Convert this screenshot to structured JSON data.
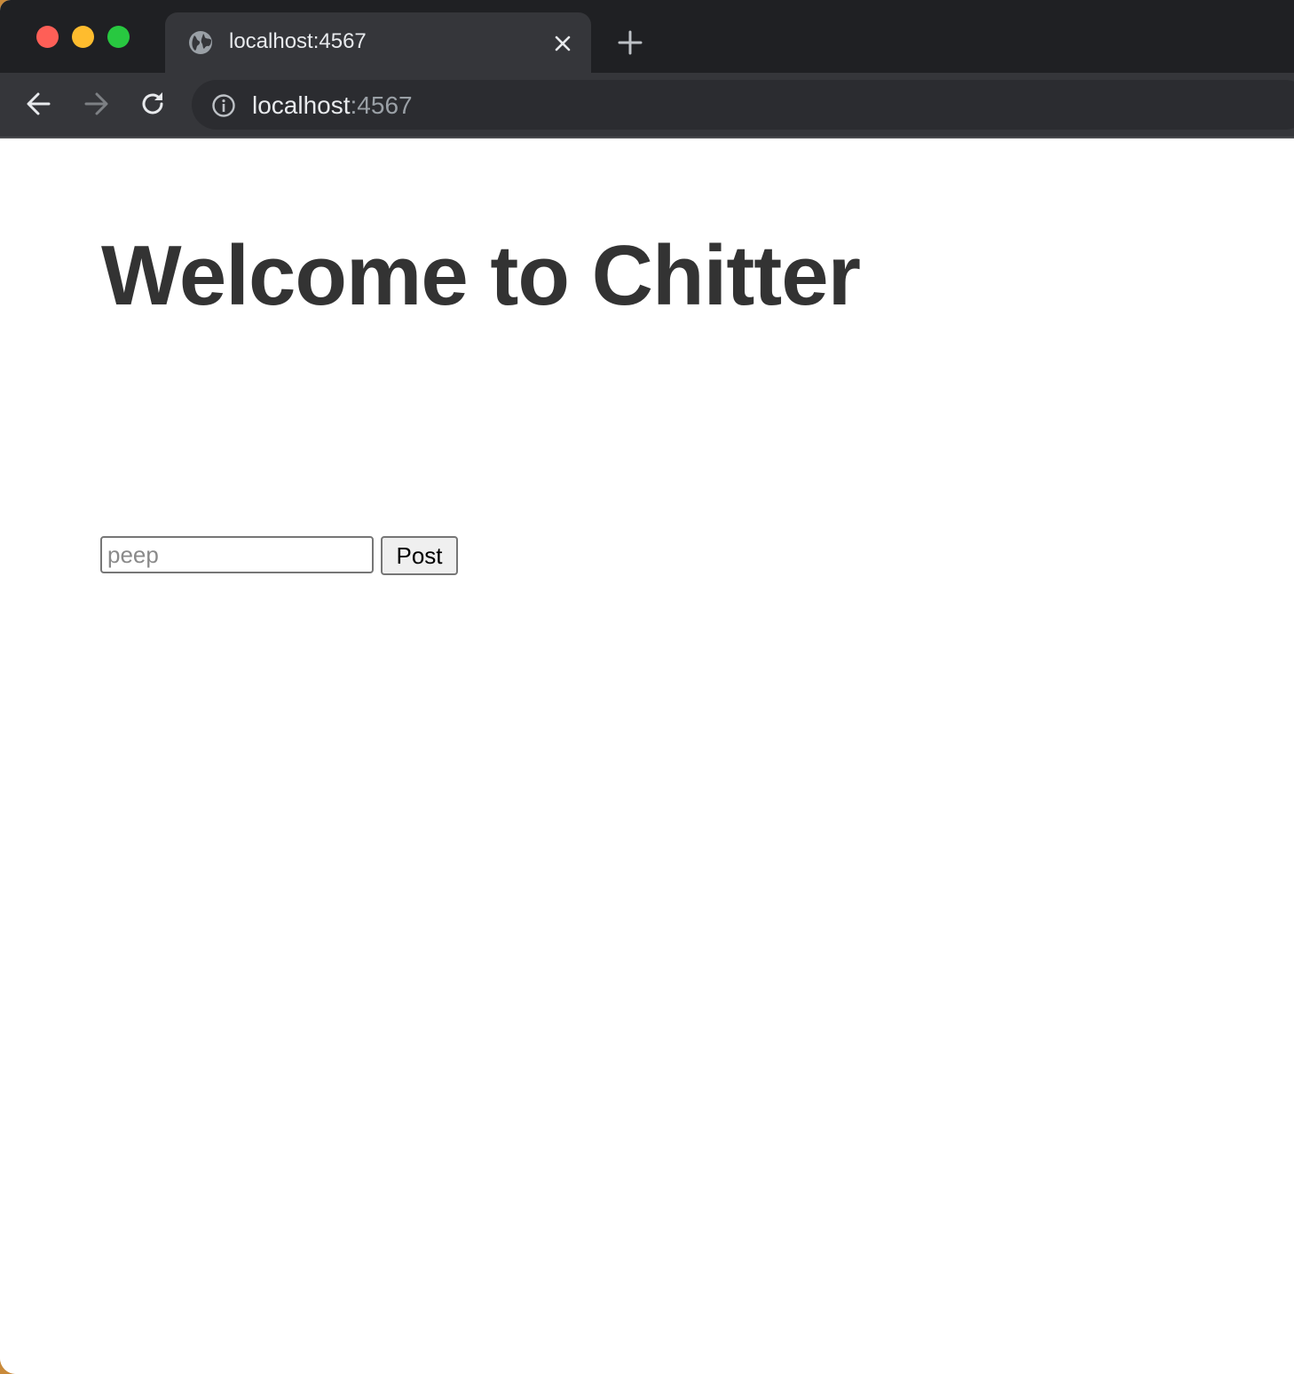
{
  "browser": {
    "tab": {
      "title": "localhost:4567",
      "favicon": "globe-icon",
      "close_icon": "close-icon"
    },
    "new_tab_icon": "plus-icon",
    "toolbar": {
      "back_icon": "arrow-left-icon",
      "forward_icon": "arrow-right-icon",
      "reload_icon": "reload-icon",
      "info_icon": "info-icon",
      "url_host": "localhost",
      "url_port": ":4567"
    },
    "colors": {
      "tabstrip": "#1f2023",
      "toolbar": "#35363a",
      "omnibox": "#2b2c30",
      "close_red": "#fe5f57",
      "minimize_yellow": "#febc2e",
      "maximize_green": "#28c840"
    }
  },
  "page": {
    "title": "Welcome to Chitter",
    "form": {
      "input_placeholder": "peep",
      "input_value": "",
      "submit_label": "Post"
    }
  }
}
